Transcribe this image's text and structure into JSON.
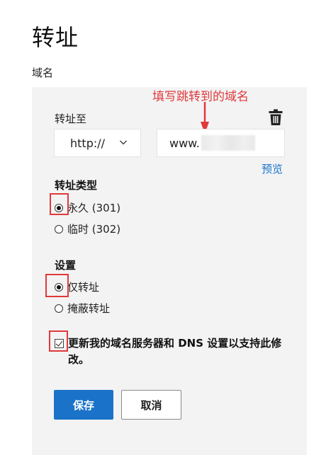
{
  "page": {
    "title": "转址",
    "section_label": "域名"
  },
  "annotation": {
    "text": "填写跳转到的域名",
    "color": "#e0393a"
  },
  "redirect": {
    "label": "转址至",
    "protocol": {
      "selected": "http://"
    },
    "domain_input": {
      "value": "www."
    },
    "preview_link": "预览",
    "delete_icon": "trash-icon"
  },
  "redirect_type": {
    "title": "转址类型",
    "options": [
      {
        "label": "永久 (301)",
        "selected": true
      },
      {
        "label": "临时 (302)",
        "selected": false
      }
    ]
  },
  "settings": {
    "title": "设置",
    "options": [
      {
        "label": "仅转址",
        "selected": true
      },
      {
        "label": "掩蔽转址",
        "selected": false
      }
    ]
  },
  "dns_update": {
    "label": "更新我的域名服务器和 DNS 设置以支持此修改。",
    "checked": true
  },
  "buttons": {
    "save": "保存",
    "cancel": "取消"
  },
  "colors": {
    "primary": "#1a73c9",
    "highlight": "#e0393a",
    "panel": "#f3f3f4"
  }
}
